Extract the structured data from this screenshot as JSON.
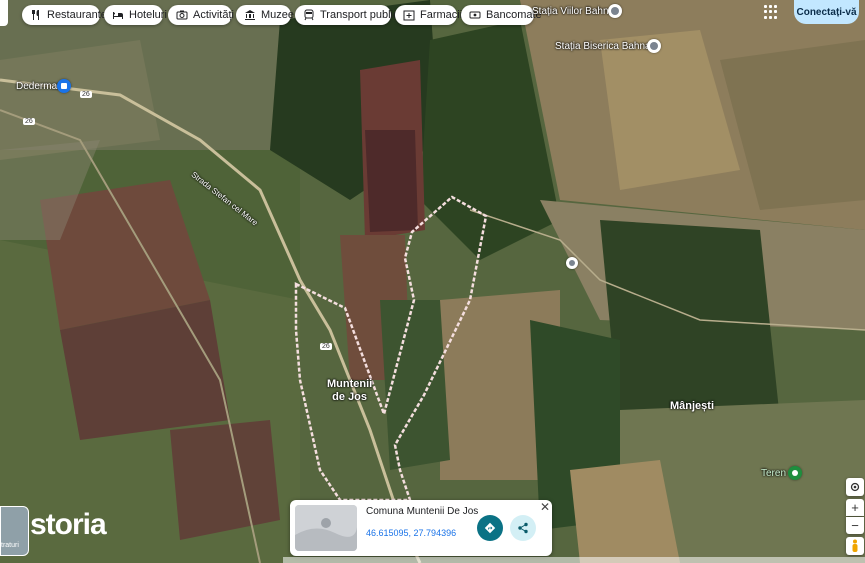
{
  "filters": [
    {
      "label": "Restaurante",
      "icon": "restaurant-icon"
    },
    {
      "label": "Hoteluri",
      "icon": "hotel-icon"
    },
    {
      "label": "Activități",
      "icon": "camera-icon"
    },
    {
      "label": "Muzee",
      "icon": "museum-icon"
    },
    {
      "label": "Transport public",
      "icon": "transit-icon"
    },
    {
      "label": "Farmacii",
      "icon": "pharmacy-icon"
    },
    {
      "label": "Bancomate",
      "icon": "atm-icon"
    }
  ],
  "account": {
    "sign_in_label": "Conectați-vă"
  },
  "map_labels": {
    "station_1": "Stația Viilor Bahnari",
    "station_2": "Stația Biserica Bahnari",
    "town_dederman": "Dederman",
    "street": "Strada Stefan cel Mare",
    "village_line1": "Muntenii",
    "village_line2": "de Jos",
    "village_manjesti": "Mânjești",
    "poi_teren": "Teren",
    "road_number": "26"
  },
  "info_card": {
    "title": "Comuna Muntenii De Jos",
    "coordinates": "46.615095, 27.794396"
  },
  "layers": {
    "label": "traturi"
  },
  "brand": {
    "watermark": "storia"
  },
  "colors": {
    "boundary": "#f4dede",
    "accent": "#1a73e8",
    "teal_button": "#0b7285"
  }
}
